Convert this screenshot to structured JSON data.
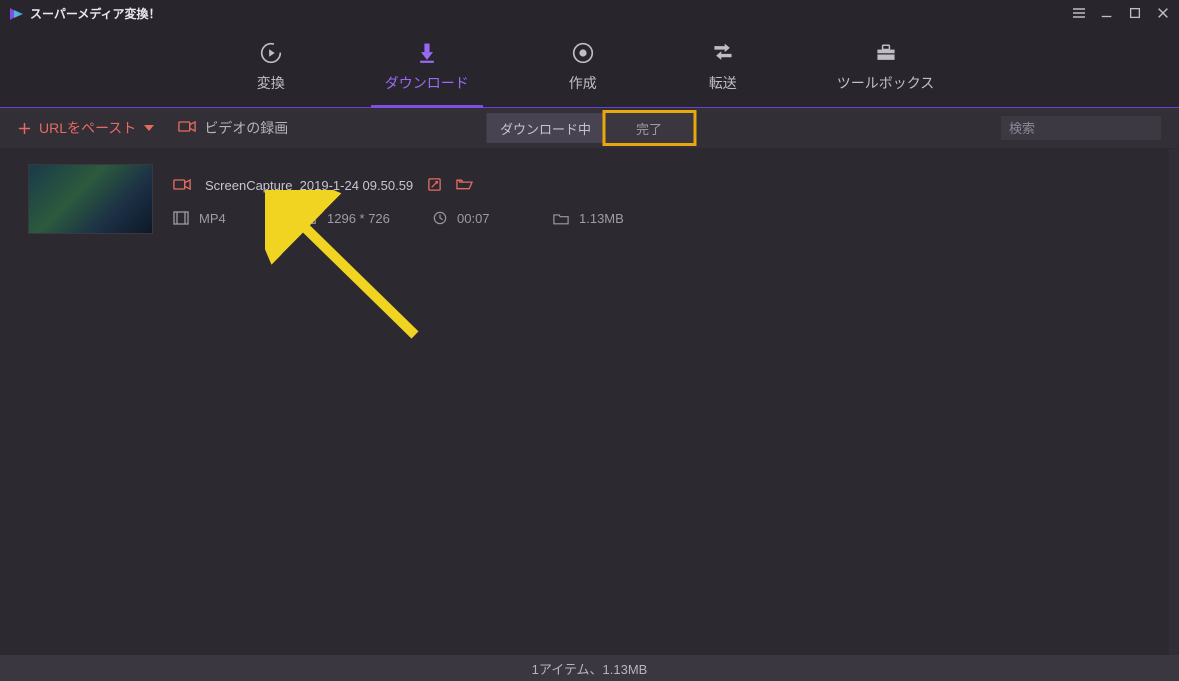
{
  "app": {
    "title": "スーパーメディア変換！"
  },
  "nav": {
    "tabs": [
      {
        "label": "変換",
        "active": false
      },
      {
        "label": "ダウンロード",
        "active": true
      },
      {
        "label": "作成",
        "active": false
      },
      {
        "label": "転送",
        "active": false
      },
      {
        "label": "ツールボックス",
        "active": false
      }
    ]
  },
  "toolbar": {
    "paste_url_label": "URLをペースト",
    "record_label": "ビデオの録画",
    "search_placeholder": "検索",
    "subtabs": {
      "downloading_label": "ダウンロード中",
      "completed_label": "完了"
    }
  },
  "item": {
    "filename": "ScreenCapture_2019-1-24 09.50.59",
    "format": "MP4",
    "resolution": "1296 * 726",
    "duration": "00:07",
    "filesize": "1.13MB"
  },
  "status": {
    "summary": "1アイテム、1.13MB"
  },
  "colors": {
    "accent": "#9a6af4",
    "danger": "#e66a60",
    "highlight": "#e9a60e"
  }
}
